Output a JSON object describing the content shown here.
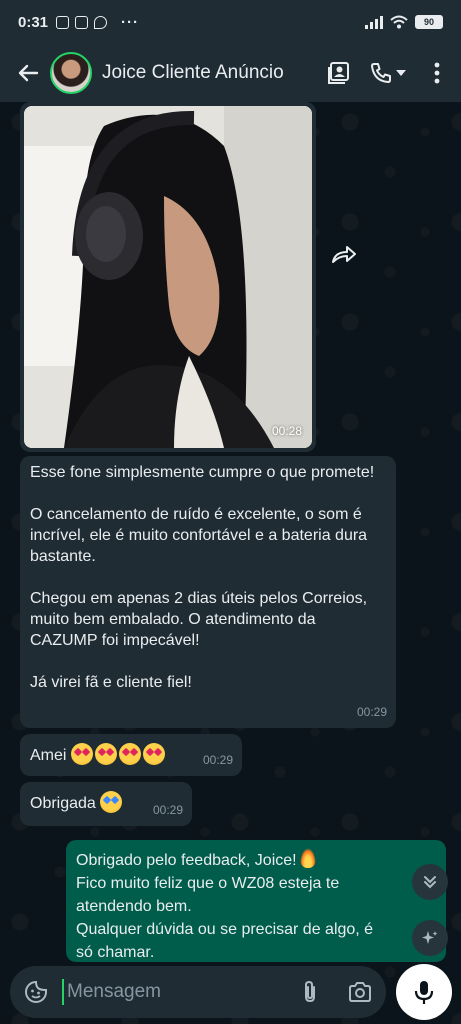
{
  "status_bar": {
    "time": "0:31",
    "battery": "90",
    "more": "···"
  },
  "header": {
    "contact_name": "Joice Cliente Anúncio"
  },
  "messages": {
    "video": {
      "timestamp": "00:28"
    },
    "review": {
      "paragraphs": [
        "Esse fone simplesmente cumpre o que promete!",
        "O cancelamento de ruído é excelente, o som é incrível, ele é muito confortável e a bateria dura bastante.",
        "Chegou em apenas 2 dias úteis pelos Correios, muito bem embalado. O atendimento da CAZUMP foi impecável!",
        "Já virei fã e cliente fiel!"
      ],
      "timestamp": "00:29"
    },
    "amei": {
      "text": "Amei",
      "timestamp": "00:29"
    },
    "obrigada": {
      "text": "Obrigada",
      "timestamp": "00:29"
    },
    "reply": {
      "lines": [
        "Obrigado pelo feedback, Joice!",
        "Fico muito feliz que o WZ08 esteja te",
        "atendendo bem.",
        "Qualquer dúvida ou se precisar de algo, é",
        "só chamar."
      ]
    }
  },
  "composer": {
    "placeholder": "Mensagem"
  },
  "colors": {
    "accent": "#25d366",
    "header_bg": "#1f2c34",
    "incoming_bubble": "#1f2c34",
    "outgoing_bubble": "#005c4b",
    "background": "#0b141a"
  },
  "icons": [
    "back-arrow-icon",
    "contact-card-icon",
    "phone-icon",
    "dropdown-icon",
    "more-vert-icon",
    "forward-icon",
    "scroll-down-icon",
    "sparkle-icon",
    "sticker-icon",
    "attach-icon",
    "camera-icon",
    "mic-icon"
  ]
}
